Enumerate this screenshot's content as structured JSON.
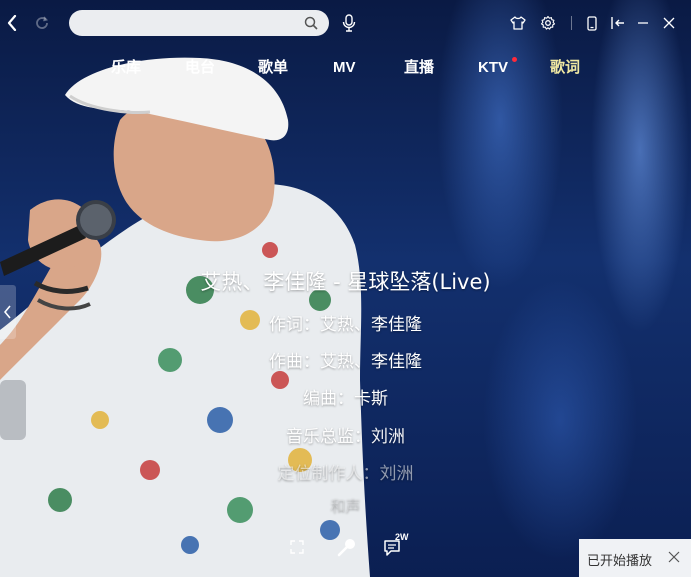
{
  "search": {
    "placeholder": "",
    "value": ""
  },
  "nav": {
    "items": [
      {
        "label": "乐库"
      },
      {
        "label": "电台"
      },
      {
        "label": "歌单"
      },
      {
        "label": "MV"
      },
      {
        "label": "直播"
      },
      {
        "label": "KTV",
        "notification": true
      },
      {
        "label": "歌词",
        "active": true
      }
    ]
  },
  "lyrics": {
    "lines": [
      "艾热、李佳隆 - 星球坠落(Live)",
      "作词：艾热、李佳隆",
      "作曲：艾热、李佳隆",
      "编曲：卡斯",
      "音乐总监：刘洲",
      "定位制作人：刘洲",
      "和声"
    ]
  },
  "comments": {
    "count_badge": "2W"
  },
  "toast": {
    "text": "已开始播放"
  },
  "icons": {
    "back": "back-arrow-icon",
    "refresh": "refresh-icon",
    "search": "search-icon",
    "voice": "microphone-icon",
    "skin": "shirt-icon",
    "settings": "gear-icon",
    "mini_mode": "phone-icon",
    "mini_player": "collapse-icon",
    "minimize": "minimize-icon",
    "close": "close-icon"
  },
  "colors": {
    "active_tab": "#f1e9a2",
    "notification_dot": "#ff2a3a",
    "background": "#13306e"
  }
}
